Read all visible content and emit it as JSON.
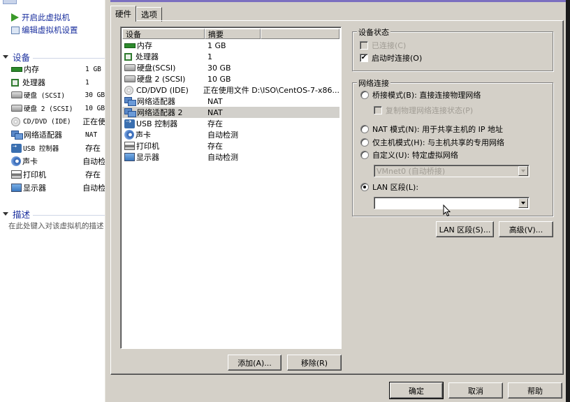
{
  "left_pane": {
    "actions": [
      {
        "label": "开启此虚拟机",
        "icon": "play-icon"
      },
      {
        "label": "编辑虚拟机设置",
        "icon": "edit-settings-icon"
      }
    ],
    "devices_section": "设备",
    "devices": [
      {
        "name": "内存",
        "value": "1 GB",
        "icon": "memory-icon"
      },
      {
        "name": "处理器",
        "value": "1",
        "icon": "processor-icon"
      },
      {
        "name": "硬盘 (SCSI)",
        "value": "30 GB",
        "icon": "harddisk-icon"
      },
      {
        "name": "硬盘 2 (SCSI)",
        "value": "10 GB",
        "icon": "harddisk-icon"
      },
      {
        "name": "CD/DVD (IDE)",
        "value": "正在使",
        "icon": "cd-dvd-icon"
      },
      {
        "name": "网络适配器",
        "value": "NAT",
        "icon": "network-adapter-icon"
      },
      {
        "name": "USB 控制器",
        "value": "存在",
        "icon": "usb-icon"
      },
      {
        "name": "声卡",
        "value": "自动检",
        "icon": "sound-card-icon"
      },
      {
        "name": "打印机",
        "value": "存在",
        "icon": "printer-icon"
      },
      {
        "name": "显示器",
        "value": "自动检",
        "icon": "display-icon"
      }
    ],
    "description_section": "描述",
    "description_placeholder": "在此处键入对该虚拟机的描述"
  },
  "dialog": {
    "tabs": [
      {
        "label": "硬件",
        "active": true
      },
      {
        "label": "选项",
        "active": false
      }
    ],
    "device_table": {
      "columns": [
        "设备",
        "摘要"
      ],
      "rows": [
        {
          "device": "内存",
          "summary": "1 GB",
          "icon": "memory-icon",
          "selected": false
        },
        {
          "device": "处理器",
          "summary": "1",
          "icon": "processor-icon",
          "selected": false
        },
        {
          "device": "硬盘(SCSI)",
          "summary": "30 GB",
          "icon": "harddisk-icon",
          "selected": false
        },
        {
          "device": "硬盘 2 (SCSI)",
          "summary": "10 GB",
          "icon": "harddisk-icon",
          "selected": false
        },
        {
          "device": "CD/DVD (IDE)",
          "summary": "正在使用文件 D:\\ISO\\CentOS-7-x86...",
          "icon": "cd-dvd-icon",
          "selected": false
        },
        {
          "device": "网络适配器",
          "summary": "NAT",
          "icon": "network-adapter-icon",
          "selected": false
        },
        {
          "device": "网络适配器 2",
          "summary": "NAT",
          "icon": "network-adapter-icon",
          "selected": true
        },
        {
          "device": "USB 控制器",
          "summary": "存在",
          "icon": "usb-icon",
          "selected": false
        },
        {
          "device": "声卡",
          "summary": "自动检测",
          "icon": "sound-card-icon",
          "selected": false
        },
        {
          "device": "打印机",
          "summary": "存在",
          "icon": "printer-icon",
          "selected": false
        },
        {
          "device": "显示器",
          "summary": "自动检测",
          "icon": "display-icon",
          "selected": false
        }
      ]
    },
    "add_button": "添加(A)...",
    "remove_button": "移除(R)",
    "device_status": {
      "title": "设备状态",
      "connected": {
        "label": "已连接(C)",
        "checked": false,
        "enabled": false
      },
      "connect_at_power_on": {
        "label": "启动时连接(O)",
        "checked": true,
        "enabled": true
      }
    },
    "network_connection": {
      "title": "网络连接",
      "bridged": {
        "label": "桥接模式(B): 直接连接物理网络",
        "selected": false
      },
      "replicate_state": {
        "label": "复制物理网络连接状态(P)",
        "checked": false,
        "enabled": false
      },
      "nat": {
        "label": "NAT 模式(N): 用于共享主机的 IP 地址",
        "selected": false
      },
      "host_only": {
        "label": "仅主机模式(H): 与主机共享的专用网络",
        "selected": false
      },
      "custom": {
        "label": "自定义(U): 特定虚拟网络",
        "selected": false
      },
      "custom_network_value": "VMnet0 (自动桥接)",
      "lan_segment": {
        "label": "LAN 区段(L):",
        "selected": true
      },
      "lan_segment_value": ""
    },
    "lan_segments_button": "LAN 区段(S)...",
    "advanced_button": "高级(V)...",
    "ok_button": "确定",
    "cancel_button": "取消",
    "help_button": "帮助"
  }
}
